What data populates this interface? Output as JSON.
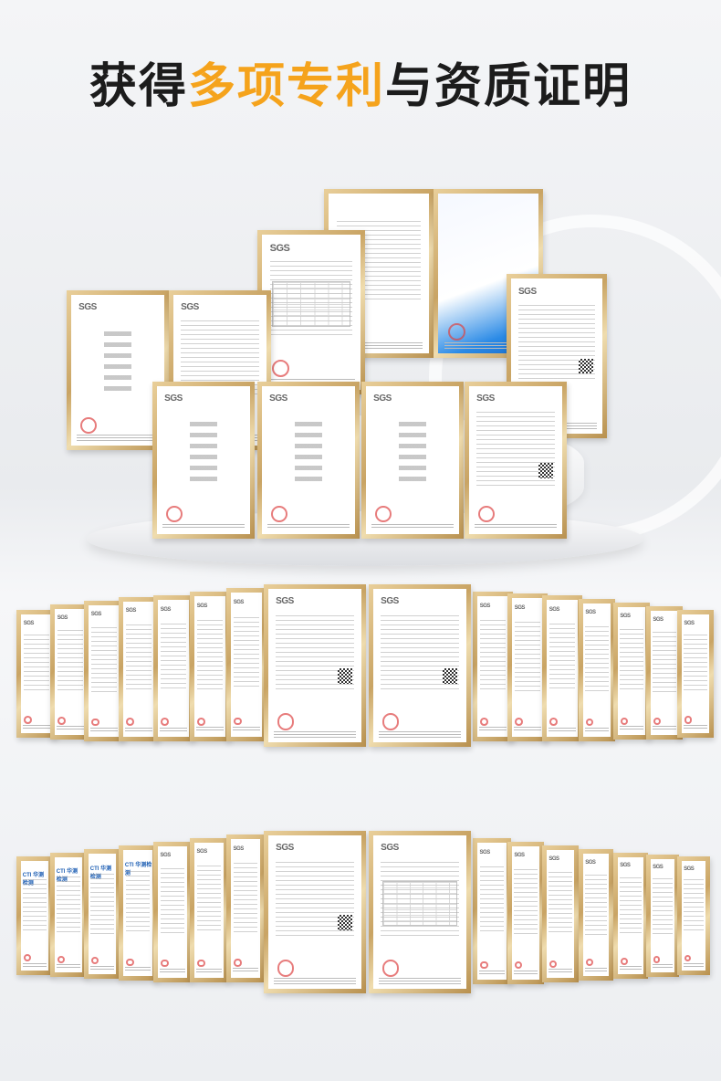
{
  "title": {
    "part1": "获得",
    "highlight": "多项专利",
    "part2": "与资质证明"
  },
  "colors": {
    "highlight": "#f5a31c",
    "title": "#1c1c1c",
    "frame_gold": "#c9a464"
  },
  "certificate_logo": "SGS",
  "cti_logo": "CTI 华测检测"
}
